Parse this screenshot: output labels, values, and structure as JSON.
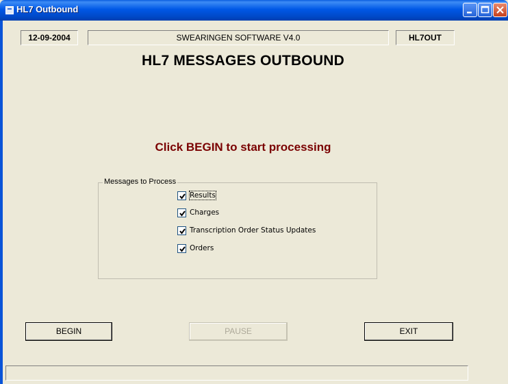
{
  "window": {
    "title": "HL7 Outbound"
  },
  "header": {
    "date": "12-09-2004",
    "software": "SWEARINGEN SOFTWARE V4.0",
    "program": "HL7OUT"
  },
  "main": {
    "heading": "HL7 MESSAGES OUTBOUND",
    "prompt": "Click BEGIN to start  processing"
  },
  "messages_group": {
    "legend": "Messages to Process",
    "options": [
      {
        "label": "Results",
        "checked": true
      },
      {
        "label": "Charges",
        "checked": true
      },
      {
        "label": "Transcription Order Status Updates",
        "checked": true
      },
      {
        "label": "Orders",
        "checked": true
      }
    ]
  },
  "buttons": {
    "begin": "BEGIN",
    "pause": "PAUSE",
    "exit": "EXIT"
  },
  "statusbar": {
    "text": ""
  },
  "colors": {
    "title_bar": "#0058e6",
    "prompt": "#7a0000",
    "background": "#ece9d8"
  }
}
